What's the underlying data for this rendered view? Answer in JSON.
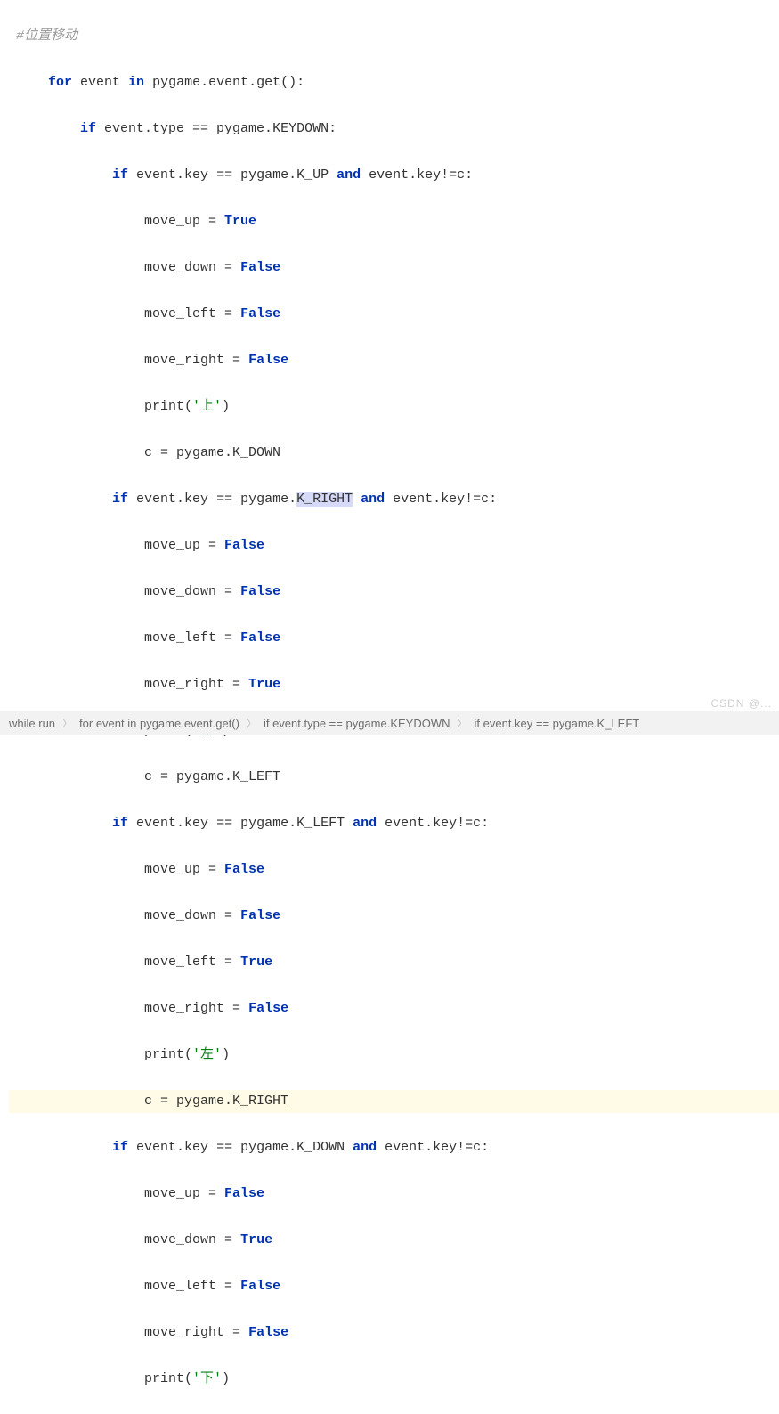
{
  "code": {
    "comment": "#位置移动",
    "for_line": {
      "kw1": "for",
      "var": " event ",
      "kw2": "in",
      "rest": " pygame.event.get():"
    },
    "if_keydown": {
      "kw": "if",
      "rest": " event.type == pygame.KEYDOWN:"
    },
    "blocks": [
      {
        "if_line": {
          "kw1": "if",
          "expr1": " event.key == pygame.K_UP ",
          "kw2": "and",
          "expr2": " event.key!=c:"
        },
        "move_up": {
          "lhs": "move_up = ",
          "val": "True"
        },
        "move_down": {
          "lhs": "move_down = ",
          "val": "False"
        },
        "move_left": {
          "lhs": "move_left = ",
          "val": "False"
        },
        "move_right": {
          "lhs": "move_right = ",
          "val": "False"
        },
        "print": {
          "fn": "print(",
          "str": "'上'",
          "close": ")"
        },
        "assign": "c = pygame.K_DOWN"
      },
      {
        "if_line": {
          "kw1": "if",
          "expr1a": " event.key == pygame.",
          "sel": "K_RIGHT",
          "expr1b": " ",
          "kw2": "and",
          "expr2": " event.key!=c:"
        },
        "move_up": {
          "lhs": "move_up = ",
          "val": "False"
        },
        "move_down": {
          "lhs": "move_down = ",
          "val": "False"
        },
        "move_left": {
          "lhs": "move_left = ",
          "val": "False"
        },
        "move_right": {
          "lhs": "move_right = ",
          "val": "True"
        },
        "print": {
          "fn": "print(",
          "str": "'右'",
          "close": ")"
        },
        "assign": "c = pygame.K_LEFT"
      },
      {
        "if_line": {
          "kw1": "if",
          "expr1": " event.key == pygame.K_LEFT ",
          "kw2": "and",
          "expr2": " event.key!=c:"
        },
        "move_up": {
          "lhs": "move_up = ",
          "val": "False"
        },
        "move_down": {
          "lhs": "move_down = ",
          "val": "False"
        },
        "move_left": {
          "lhs": "move_left = ",
          "val": "True"
        },
        "move_right": {
          "lhs": "move_right = ",
          "val": "False"
        },
        "print": {
          "fn": "print(",
          "str": "'左'",
          "close": ")"
        },
        "assign": "c = pygame.K_RIGHT",
        "highlighted": true
      },
      {
        "if_line": {
          "kw1": "if",
          "expr1": " event.key == pygame.K_DOWN ",
          "kw2": "and",
          "expr2": " event.key!=c:"
        },
        "move_up": {
          "lhs": "move_up = ",
          "val": "False"
        },
        "move_down": {
          "lhs": "move_down = ",
          "val": "True"
        },
        "move_left": {
          "lhs": "move_left = ",
          "val": "False"
        },
        "move_right": {
          "lhs": "move_right = ",
          "val": "False"
        },
        "print": {
          "fn": "print(",
          "str": "'下'",
          "close": ")"
        }
      }
    ]
  },
  "breadcrumb": {
    "items": [
      "while run",
      "for event in pygame.event.get()",
      "if event.type == pygame.KEYDOWN",
      "if event.key == pygame.K_LEFT"
    ]
  },
  "watermark": "CSDN @..."
}
